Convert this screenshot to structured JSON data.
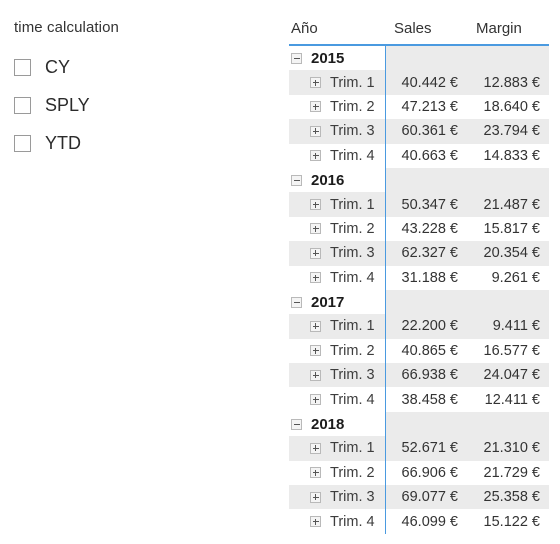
{
  "slicer": {
    "title": "time calculation",
    "items": [
      {
        "label": "CY",
        "checked": false
      },
      {
        "label": "SPLY",
        "checked": false
      },
      {
        "label": "YTD",
        "checked": false
      }
    ]
  },
  "matrix": {
    "columns": [
      "Año",
      "Sales",
      "Margin"
    ],
    "accent_color": "#4a9ae0",
    "stripe_color": "#ebebeb",
    "expand_icon_year": "minus-box-icon",
    "expand_icon_quarter": "plus-box-icon",
    "rows": [
      {
        "type": "year",
        "label": "2015",
        "sales": "",
        "margin": ""
      },
      {
        "type": "quarter",
        "label": "Trim. 1",
        "sales": "40.442 €",
        "margin": "12.883 €"
      },
      {
        "type": "quarter",
        "label": "Trim. 2",
        "sales": "47.213 €",
        "margin": "18.640 €"
      },
      {
        "type": "quarter",
        "label": "Trim. 3",
        "sales": "60.361 €",
        "margin": "23.794 €"
      },
      {
        "type": "quarter",
        "label": "Trim. 4",
        "sales": "40.663 €",
        "margin": "14.833 €"
      },
      {
        "type": "year",
        "label": "2016",
        "sales": "",
        "margin": ""
      },
      {
        "type": "quarter",
        "label": "Trim. 1",
        "sales": "50.347 €",
        "margin": "21.487 €"
      },
      {
        "type": "quarter",
        "label": "Trim. 2",
        "sales": "43.228 €",
        "margin": "15.817 €"
      },
      {
        "type": "quarter",
        "label": "Trim. 3",
        "sales": "62.327 €",
        "margin": "20.354 €"
      },
      {
        "type": "quarter",
        "label": "Trim. 4",
        "sales": "31.188 €",
        "margin": "9.261 €"
      },
      {
        "type": "year",
        "label": "2017",
        "sales": "",
        "margin": ""
      },
      {
        "type": "quarter",
        "label": "Trim. 1",
        "sales": "22.200 €",
        "margin": "9.411 €"
      },
      {
        "type": "quarter",
        "label": "Trim. 2",
        "sales": "40.865 €",
        "margin": "16.577 €"
      },
      {
        "type": "quarter",
        "label": "Trim. 3",
        "sales": "66.938 €",
        "margin": "24.047 €"
      },
      {
        "type": "quarter",
        "label": "Trim. 4",
        "sales": "38.458 €",
        "margin": "12.411 €"
      },
      {
        "type": "year",
        "label": "2018",
        "sales": "",
        "margin": ""
      },
      {
        "type": "quarter",
        "label": "Trim. 1",
        "sales": "52.671 €",
        "margin": "21.310 €"
      },
      {
        "type": "quarter",
        "label": "Trim. 2",
        "sales": "66.906 €",
        "margin": "21.729 €"
      },
      {
        "type": "quarter",
        "label": "Trim. 3",
        "sales": "69.077 €",
        "margin": "25.358 €"
      },
      {
        "type": "quarter",
        "label": "Trim. 4",
        "sales": "46.099 €",
        "margin": "15.122 €"
      }
    ]
  }
}
